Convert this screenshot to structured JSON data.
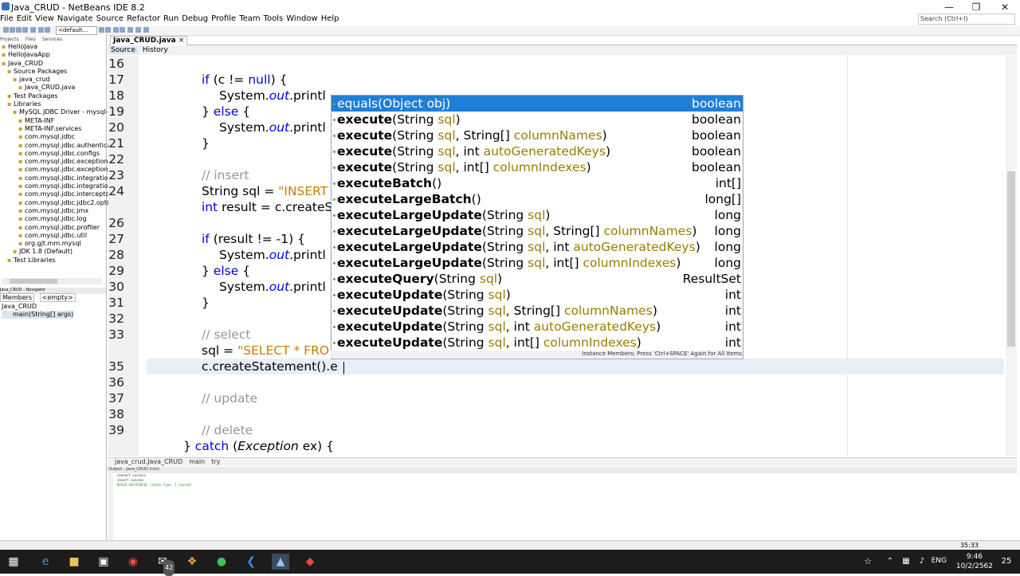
{
  "window": {
    "title": "Java_CRUD - NetBeans IDE 8.2",
    "search_placeholder": "Search (Ctrl+I)"
  },
  "menu": [
    "File",
    "Edit",
    "View",
    "Navigate",
    "Source",
    "Refactor",
    "Run",
    "Debug",
    "Profile",
    "Team",
    "Tools",
    "Window",
    "Help"
  ],
  "toolbar": {
    "config": "<default..."
  },
  "left_tabs": [
    "Projects",
    "Files",
    "Services"
  ],
  "project_tree": [
    {
      "indent": 0,
      "label": "HelloJava"
    },
    {
      "indent": 0,
      "label": "HelloJavaApp"
    },
    {
      "indent": 0,
      "label": "Java_CRUD"
    },
    {
      "indent": 1,
      "label": "Source Packages"
    },
    {
      "indent": 2,
      "label": "java_crud"
    },
    {
      "indent": 3,
      "label": "Java_CRUD.java"
    },
    {
      "indent": 1,
      "label": "Test Packages"
    },
    {
      "indent": 1,
      "label": "Libraries"
    },
    {
      "indent": 2,
      "label": "MySQL JDBC Driver - mysql-c"
    },
    {
      "indent": 3,
      "label": "META-INF"
    },
    {
      "indent": 3,
      "label": "META-INF.services"
    },
    {
      "indent": 3,
      "label": "com.mysql.jdbc"
    },
    {
      "indent": 3,
      "label": "com.mysql.jdbc.authenticat"
    },
    {
      "indent": 3,
      "label": "com.mysql.jdbc.configs"
    },
    {
      "indent": 3,
      "label": "com.mysql.jdbc.exceptions"
    },
    {
      "indent": 3,
      "label": "com.mysql.jdbc.exceptions."
    },
    {
      "indent": 3,
      "label": "com.mysql.jdbc.integration."
    },
    {
      "indent": 3,
      "label": "com.mysql.jdbc.integration."
    },
    {
      "indent": 3,
      "label": "com.mysql.jdbc.interceptors"
    },
    {
      "indent": 3,
      "label": "com.mysql.jdbc.jdbc2.option"
    },
    {
      "indent": 3,
      "label": "com.mysql.jdbc.jmx"
    },
    {
      "indent": 3,
      "label": "com.mysql.jdbc.log"
    },
    {
      "indent": 3,
      "label": "com.mysql.jdbc.profiler"
    },
    {
      "indent": 3,
      "label": "com.mysql.jdbc.util"
    },
    {
      "indent": 3,
      "label": "org.gjt.mm.mysql"
    },
    {
      "indent": 2,
      "label": "JDK 1.8 (Default)"
    },
    {
      "indent": 1,
      "label": "Test Libraries"
    }
  ],
  "navigator": {
    "header": "Java_CRUD - Navigator",
    "filter": "Members",
    "empty": "<empty>",
    "items": [
      "Java_CRUD",
      "main(String[] args)"
    ]
  },
  "editor": {
    "file_tab": "Java_CRUD.java",
    "source_tab": "Source",
    "history_tab": "History",
    "line_numbers": [
      "16",
      "17",
      "18",
      "19",
      "20",
      "21",
      "22",
      "23",
      "24",
      "",
      "26",
      "27",
      "28",
      "29",
      "30",
      "31",
      "32",
      "33",
      "",
      "35",
      "36",
      "37",
      "38",
      "39"
    ]
  },
  "completion": {
    "items": [
      {
        "name": "equals",
        "bold": false,
        "params": "(Object obj)",
        "ret": "boolean",
        "selected": true
      },
      {
        "name": "execute",
        "bold": true,
        "params": "(String sql)",
        "ret": "boolean"
      },
      {
        "name": "execute",
        "bold": true,
        "params": "(String sql, String[] columnNames)",
        "ret": "boolean"
      },
      {
        "name": "execute",
        "bold": true,
        "params": "(String sql, int autoGeneratedKeys)",
        "ret": "boolean"
      },
      {
        "name": "execute",
        "bold": true,
        "params": "(String sql, int[] columnIndexes)",
        "ret": "boolean"
      },
      {
        "name": "executeBatch",
        "bold": true,
        "params": "()",
        "ret": "int[]"
      },
      {
        "name": "executeLargeBatch",
        "bold": true,
        "params": "()",
        "ret": "long[]"
      },
      {
        "name": "executeLargeUpdate",
        "bold": true,
        "params": "(String sql)",
        "ret": "long"
      },
      {
        "name": "executeLargeUpdate",
        "bold": true,
        "params": "(String sql, String[] columnNames)",
        "ret": "long"
      },
      {
        "name": "executeLargeUpdate",
        "bold": true,
        "params": "(String sql, int autoGeneratedKeys)",
        "ret": "long"
      },
      {
        "name": "executeLargeUpdate",
        "bold": true,
        "params": "(String sql, int[] columnIndexes)",
        "ret": "long"
      },
      {
        "name": "executeQuery",
        "bold": true,
        "params": "(String sql)",
        "ret": "ResultSet"
      },
      {
        "name": "executeUpdate",
        "bold": true,
        "params": "(String sql)",
        "ret": "int"
      },
      {
        "name": "executeUpdate",
        "bold": true,
        "params": "(String sql, String[] columnNames)",
        "ret": "int"
      },
      {
        "name": "executeUpdate",
        "bold": true,
        "params": "(String sql, int autoGeneratedKeys)",
        "ret": "int"
      },
      {
        "name": "executeUpdate",
        "bold": true,
        "params": "(String sql, int[] columnIndexes)",
        "ret": "int"
      }
    ],
    "hint": "Instance Members; Press 'Ctrl+SPACE' Again for All Items"
  },
  "code_text": {
    "l17a": "if",
    "l17b": " (c != ",
    "l17c": "null",
    "l17d": ") {",
    "l18a": "System.",
    "l18b": "out",
    "l18c": ".printl",
    "l19a": "} ",
    "l19b": "else",
    "l19c": " {",
    "l20a": "System.",
    "l20b": "out",
    "l20c": ".printl",
    "l21": "}",
    "l23": "// insert",
    "l24a": "String sql = ",
    "l24b": "\"INSERT",
    "l25a": "int",
    "l25b": " result = c.createS",
    "l27a": "if",
    "l27b": " (result != -1) {",
    "l28a": "System.",
    "l28b": "out",
    "l28c": ".printl",
    "l29a": "} ",
    "l29b": "else",
    "l29c": " {",
    "l30a": "System.",
    "l30b": "out",
    "l30c": ".printl",
    "l31": "}",
    "l33": "// select",
    "l34a": "sql = ",
    "l34b": "\"SELECT * FRO",
    "l35": "c.createStatement().e",
    "l37": "// update",
    "l39": "// delete",
    "l40a": "} ",
    "l40b": "catch",
    "l40c": " (",
    "l40d": "Exception",
    "l40e": " ex) {"
  },
  "breadcrumb": [
    "java_crud.Java_CRUD",
    "main",
    "try"
  ],
  "output": {
    "header": "Output - Java_CRUD (run)",
    "lines": [
      "connect success",
      "insert success",
      "BUILD SUCCESSFUL (total time: 1 second)"
    ]
  },
  "status": {
    "position": "35:33"
  },
  "taskbar": {
    "time": "9:46",
    "date": "10/2/2562",
    "lang": "ENG",
    "mail_badge": "42",
    "notif_count": "25"
  }
}
